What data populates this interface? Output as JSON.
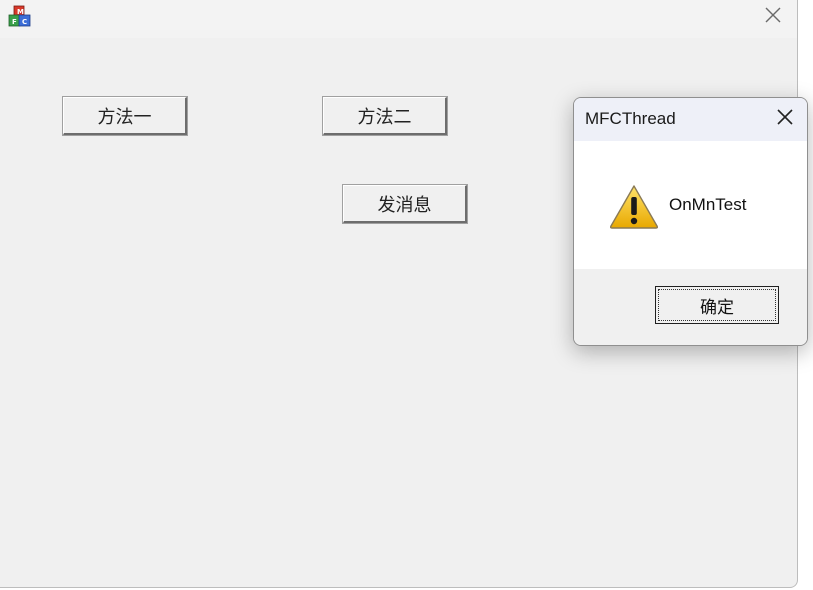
{
  "main_window": {
    "buttons": {
      "method1": "方法一",
      "method2": "方法二",
      "send_message": "发消息"
    }
  },
  "dialog": {
    "title": "MFCThread",
    "message": "OnMnTest",
    "icon": "warning-icon",
    "ok_label": "确定"
  }
}
